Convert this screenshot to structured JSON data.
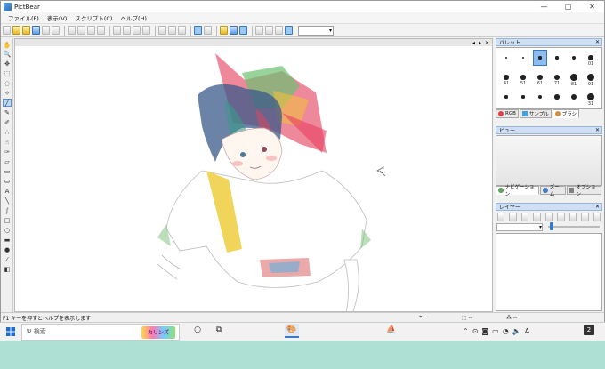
{
  "window": {
    "title": "PictBear",
    "controls": [
      "—",
      "▢",
      "✕"
    ]
  },
  "menu": [
    "ファイル(F)",
    "表示(V)",
    "スクリプト(C)",
    "ヘルプ(H)"
  ],
  "toolbar": {
    "zoom_value": ""
  },
  "canvas_head": [
    "◂",
    "▸",
    "✕"
  ],
  "palette": {
    "title": "パレット",
    "close": "✕",
    "brushes": [
      {
        "label": "",
        "size": 1
      },
      {
        "label": "",
        "size": 1
      },
      {
        "label": "",
        "size": 2,
        "selected": true
      },
      {
        "label": "",
        "size": 2
      },
      {
        "label": "",
        "size": 3
      },
      {
        "label": "01",
        "size": 4
      },
      {
        "label": "41",
        "size": 4
      },
      {
        "label": "51",
        "size": 4
      },
      {
        "label": "61",
        "size": 5
      },
      {
        "label": "71",
        "size": 5
      },
      {
        "label": "81",
        "size": 6
      },
      {
        "label": "91",
        "size": 7
      },
      {
        "label": "",
        "size": 2
      },
      {
        "label": "",
        "size": 2
      },
      {
        "label": "",
        "size": 3
      },
      {
        "label": "",
        "size": 4
      },
      {
        "label": "",
        "size": 5
      },
      {
        "label": "31",
        "size": 6
      }
    ],
    "tabs": [
      "RGB",
      "サンプル",
      "ブラシ"
    ]
  },
  "view": {
    "title": "ビュー",
    "close": "✕",
    "tabs": [
      "ナビゲーション",
      "ズーム",
      "オプション"
    ]
  },
  "layer": {
    "title": "レイヤー",
    "close": "✕"
  },
  "status": {
    "help": "F1 キーを押すとヘルプを表示します",
    "cell1": "--",
    "cell2": "--",
    "cell3": "--"
  },
  "taskbar": {
    "search_placeholder": "Ψ 検索",
    "search_logo": "カリンズ",
    "ime": "A",
    "notif": "2"
  },
  "colors": {
    "titlebar_bg": "#ffffff",
    "panel_head": "#cfe0f5",
    "accent": "#3a78c0",
    "desktop": "#aee0d4"
  }
}
